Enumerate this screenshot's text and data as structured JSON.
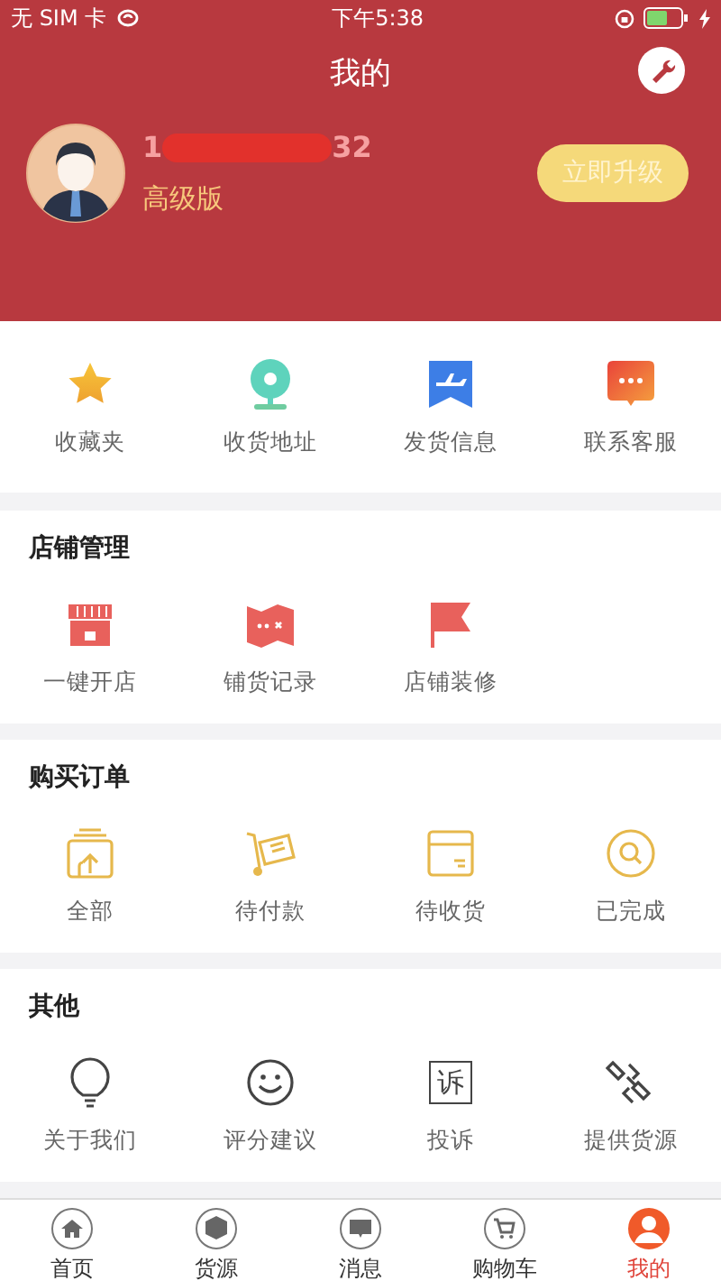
{
  "status_bar": {
    "carrier": "无 SIM 卡",
    "time": "下午5:38"
  },
  "header": {
    "title": "我的"
  },
  "profile": {
    "phone_start": "1",
    "phone_end": "32",
    "level": "高级版",
    "upgrade_button": "立即升级"
  },
  "quick_links": [
    {
      "label": "收藏夹",
      "kind": "star"
    },
    {
      "label": "收货地址",
      "kind": "pin"
    },
    {
      "label": "发货信息",
      "kind": "plane"
    },
    {
      "label": "联系客服",
      "kind": "chat"
    }
  ],
  "sections": [
    {
      "title": "店铺管理",
      "items": [
        {
          "label": "一键开店",
          "kind": "store"
        },
        {
          "label": "铺货记录",
          "kind": "map"
        },
        {
          "label": "店铺装修",
          "kind": "flag"
        }
      ]
    },
    {
      "title": "购买订单",
      "items": [
        {
          "label": "全部",
          "kind": "stack"
        },
        {
          "label": "待付款",
          "kind": "trolley"
        },
        {
          "label": "待收货",
          "kind": "package"
        },
        {
          "label": "已完成",
          "kind": "search"
        }
      ]
    },
    {
      "title": "其他",
      "items": [
        {
          "label": "关于我们",
          "kind": "bulb"
        },
        {
          "label": "评分建议",
          "kind": "smile"
        },
        {
          "label": "投诉",
          "kind": "glyph",
          "glyph": "诉"
        },
        {
          "label": "提供货源",
          "kind": "link"
        }
      ]
    }
  ],
  "tab_bar": [
    {
      "label": "首页",
      "kind": "home",
      "selected": false
    },
    {
      "label": "货源",
      "kind": "cube",
      "selected": false
    },
    {
      "label": "消息",
      "kind": "message",
      "selected": false
    },
    {
      "label": "购物车",
      "kind": "cart",
      "selected": false
    },
    {
      "label": "我的",
      "kind": "person",
      "selected": true
    }
  ]
}
